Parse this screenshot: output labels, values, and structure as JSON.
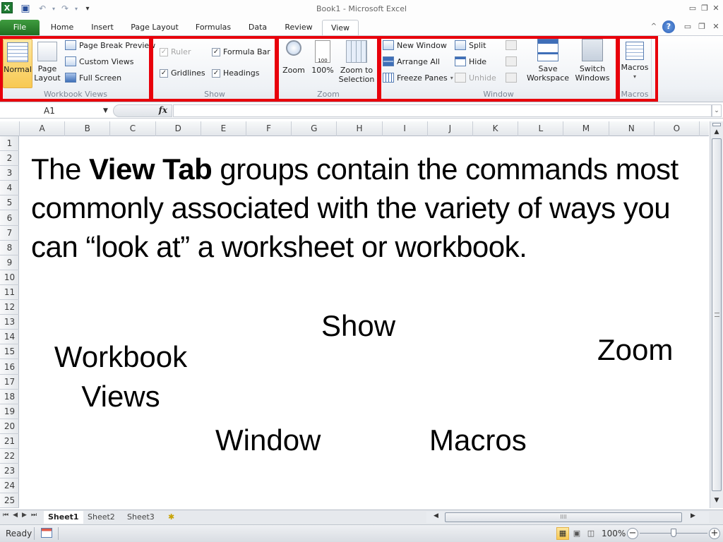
{
  "window": {
    "title": "Book1  -  Microsoft Excel",
    "qat": [
      {
        "icon": "excel-logo-icon"
      },
      {
        "icon": "save-icon"
      },
      {
        "icon": "undo-icon"
      },
      {
        "icon": "redo-icon"
      },
      {
        "icon": "customize-qat-icon"
      }
    ],
    "controls": {
      "minimize": "▭",
      "restore": "❐",
      "close": "✕"
    }
  },
  "tabs": [
    {
      "label": "File"
    },
    {
      "label": "Home"
    },
    {
      "label": "Insert"
    },
    {
      "label": "Page Layout"
    },
    {
      "label": "Formulas"
    },
    {
      "label": "Data"
    },
    {
      "label": "Review"
    },
    {
      "label": "View",
      "active": true
    }
  ],
  "tab_controls": {
    "collapse": "^",
    "help": "?",
    "minimize": "▭",
    "restore": "❐",
    "close": "✕"
  },
  "ribbon": {
    "workbook_views": {
      "label": "Workbook Views",
      "normal": "Normal",
      "page_layout": "Page Layout",
      "page_break_preview": "Page Break Preview",
      "custom_views": "Custom Views",
      "full_screen": "Full Screen"
    },
    "show": {
      "label": "Show",
      "ruler": {
        "label": "Ruler",
        "checked": true,
        "disabled": true
      },
      "formula_bar": {
        "label": "Formula Bar",
        "checked": true
      },
      "gridlines": {
        "label": "Gridlines",
        "checked": true
      },
      "headings": {
        "label": "Headings",
        "checked": true
      }
    },
    "zoom": {
      "label": "Zoom",
      "zoom": "Zoom",
      "hundred": "100%",
      "zoom_to_selection": "Zoom to Selection"
    },
    "window": {
      "label": "Window",
      "new_window": "New Window",
      "arrange_all": "Arrange All",
      "freeze_panes": "Freeze Panes",
      "split": "Split",
      "hide": "Hide",
      "unhide": "Unhide",
      "save_workspace": "Save Workspace",
      "switch_windows": "Switch Windows"
    },
    "macros": {
      "label": "Macros",
      "macros": "Macros"
    }
  },
  "formula_bar": {
    "name_box": "A1",
    "fx": "fx",
    "value": ""
  },
  "columns": [
    "A",
    "B",
    "C",
    "D",
    "E",
    "F",
    "G",
    "H",
    "I",
    "J",
    "K",
    "L",
    "M",
    "N",
    "O"
  ],
  "rows": [
    "1",
    "2",
    "3",
    "4",
    "5",
    "6",
    "7",
    "8",
    "9",
    "10",
    "11",
    "12",
    "13",
    "14",
    "15",
    "16",
    "17",
    "18",
    "19",
    "20",
    "21",
    "22",
    "23",
    "24",
    "25"
  ],
  "overlay": {
    "para_pre": "The ",
    "para_bold": "View Tab",
    "para_post": " groups contain the commands most commonly associated with the variety of ways you can “look at” a worksheet or workbook.",
    "label_show": "Show",
    "label_zoom": "Zoom",
    "label_workbook_views_1": "Workbook",
    "label_workbook_views_2": "Views",
    "label_window": "Window",
    "label_macros": "Macros"
  },
  "sheets": [
    {
      "label": "Sheet1",
      "active": true
    },
    {
      "label": "Sheet2"
    },
    {
      "label": "Sheet3"
    }
  ],
  "status": {
    "ready": "Ready",
    "zoom_level": "100%",
    "zoom_fraction": 0.5
  },
  "colors": {
    "highlight_red": "#e8000b",
    "file_tab_green": "#2a7d2e",
    "accent_blue": "#3e6db5"
  }
}
